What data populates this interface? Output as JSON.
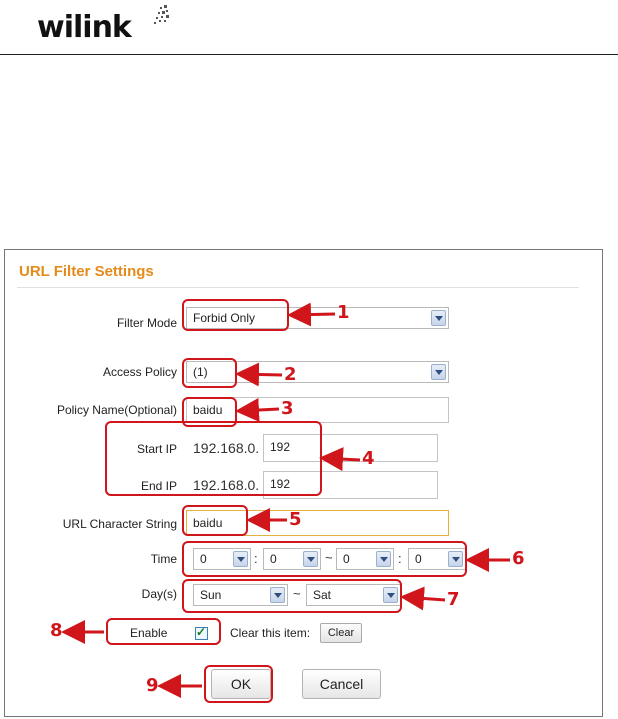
{
  "brand": {
    "logo_text": "wilink"
  },
  "panel": {
    "title": "URL Filter Settings"
  },
  "form": {
    "filter_mode": {
      "label": "Filter Mode",
      "value": "Forbid Only"
    },
    "access_policy": {
      "label": "Access Policy",
      "value": "(1)"
    },
    "policy_name": {
      "label": "Policy Name(Optional)",
      "value": "baidu"
    },
    "start_ip": {
      "label": "Start IP",
      "prefix": "192.168.0.",
      "value": "192"
    },
    "end_ip": {
      "label": "End IP",
      "prefix": "192.168.0.",
      "value": "192"
    },
    "url_string": {
      "label": "URL Character String",
      "value": "baidu"
    },
    "time": {
      "label": "Time",
      "start_hour": "0",
      "start_min": "0",
      "end_hour": "0",
      "end_min": "0",
      "colon": ":",
      "tilde": "~"
    },
    "days": {
      "label": "Day(s)",
      "from": "Sun",
      "to": "Sat",
      "tilde": "~"
    },
    "enable": {
      "label": "Enable",
      "checked": true
    },
    "clear": {
      "label": "Clear this item:",
      "button": "Clear"
    },
    "ok_button": "OK",
    "cancel_button": "Cancel"
  },
  "callouts": [
    "1",
    "2",
    "3",
    "4",
    "5",
    "6",
    "7",
    "8",
    "9"
  ],
  "colors": {
    "accent": "#e48b1c",
    "callout": "#d0151b"
  }
}
